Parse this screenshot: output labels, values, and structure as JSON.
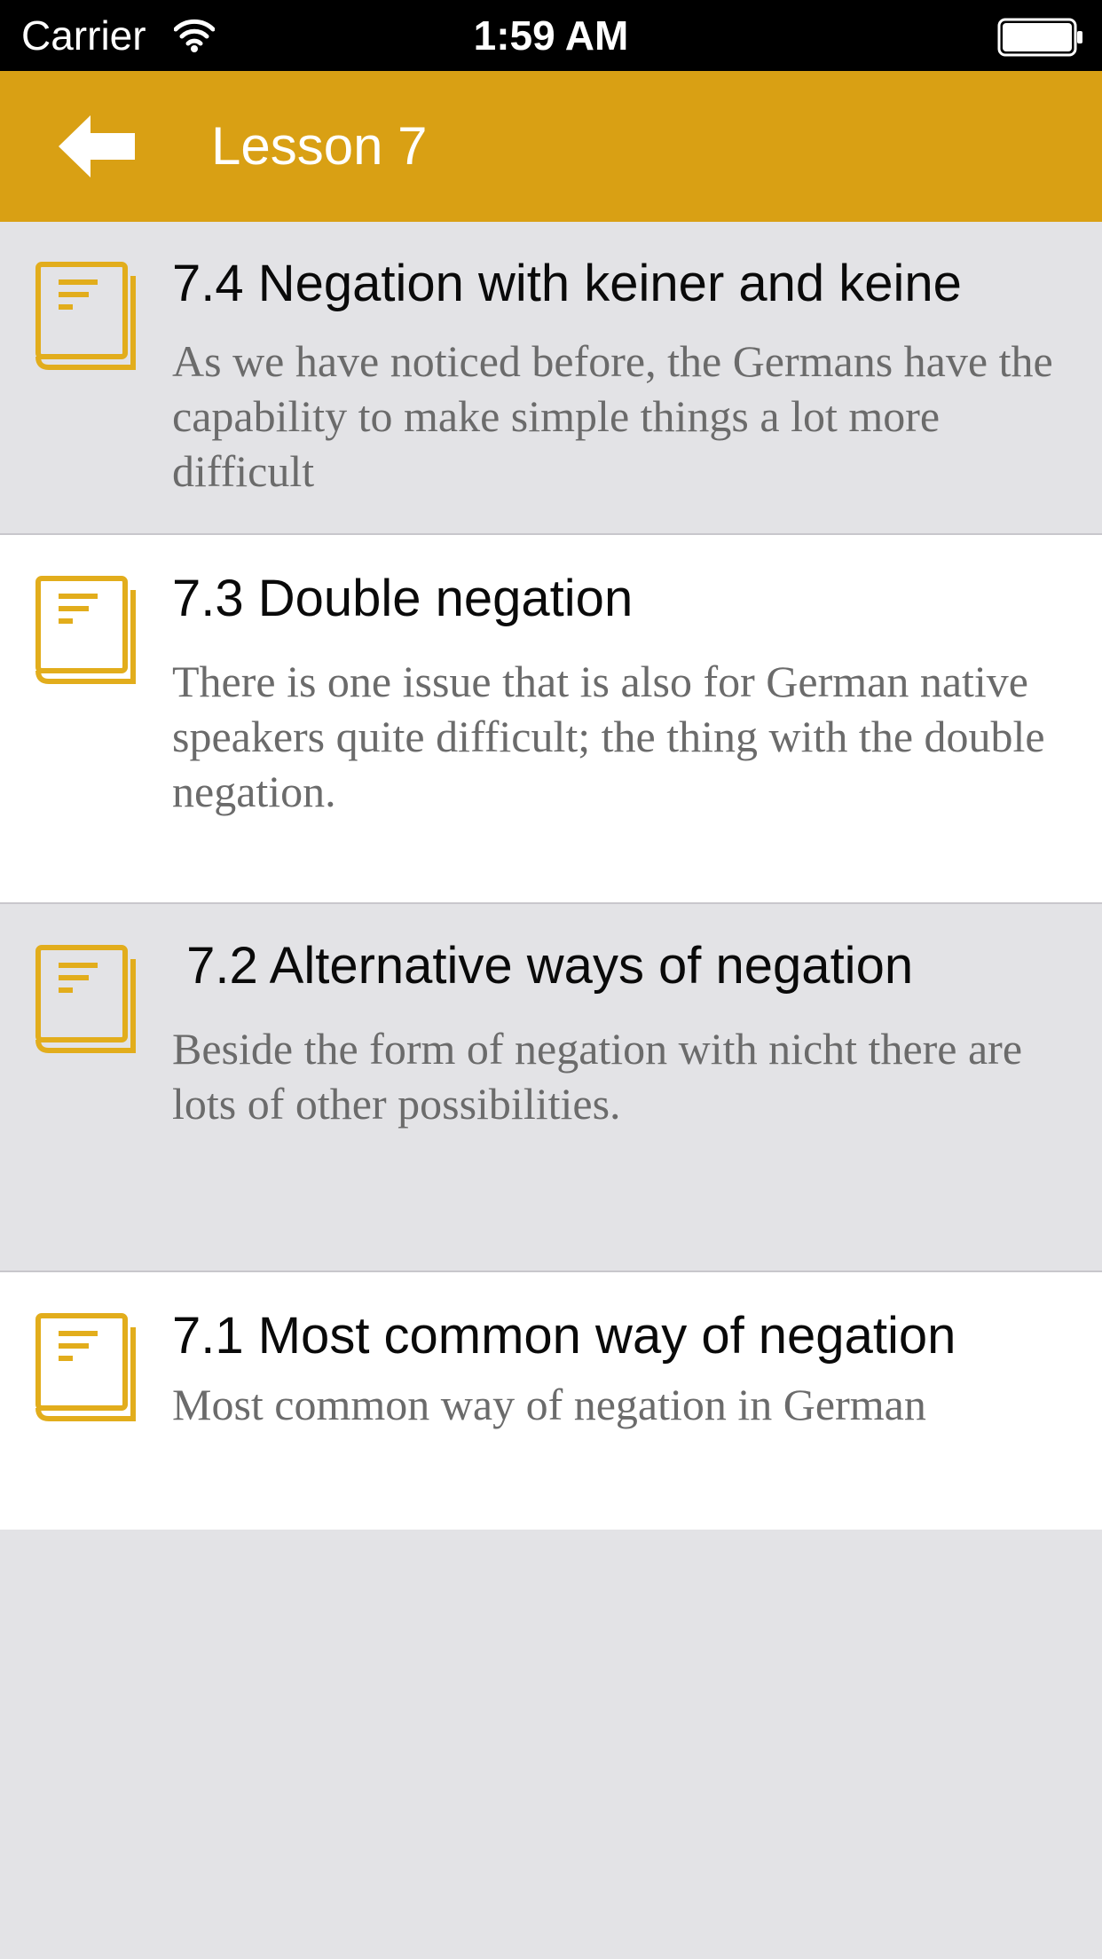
{
  "status_bar": {
    "carrier": "Carrier",
    "time": "1:59 AM",
    "wifi_icon": "wifi-icon",
    "battery_icon": "battery-icon"
  },
  "nav": {
    "back_icon": "back-arrow-icon",
    "title": "Lesson 7"
  },
  "colors": {
    "accent": "#d9a014",
    "book_icon": "#e2ad1c",
    "status_bar_bg": "#000000",
    "shaded_row": "#e3e3e6",
    "plain_row": "#ffffff",
    "title_text": "#0a0a0a",
    "desc_text": "#6b6b6b"
  },
  "lessons": [
    {
      "icon": "book-icon",
      "title": "7.4 Negation with keiner and keine",
      "description": "As we have noticed before, the Germans have the capability to make simple things a lot more difficult"
    },
    {
      "icon": "book-icon",
      "title": "7.3 Double negation",
      "description": "There is one issue that is also for German native speakers quite difficult; the thing with the double negation."
    },
    {
      "icon": "book-icon",
      "title": " 7.2 Alternative ways of negation",
      "description": "Beside the form of negation with nicht there are lots of other possibilities."
    },
    {
      "icon": "book-icon",
      "title": "7.1 Most common way of negation",
      "description": "Most common way of negation in German"
    }
  ]
}
